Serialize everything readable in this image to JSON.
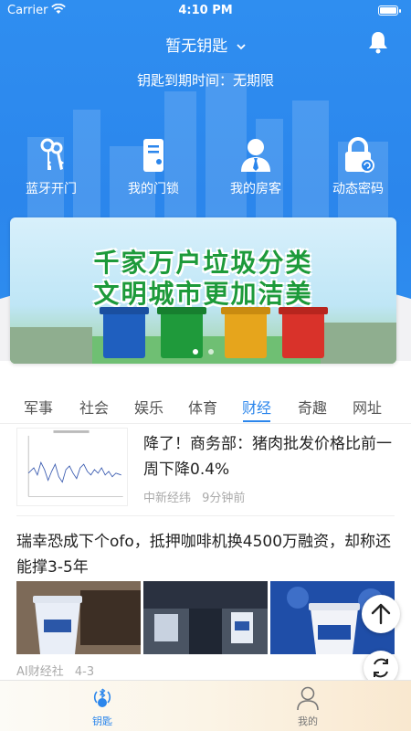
{
  "status_bar": {
    "carrier": "Carrier",
    "time": "4:10 PM"
  },
  "header": {
    "title": "暂无钥匙",
    "expiry": "钥匙到期时间：无期限"
  },
  "actions": [
    {
      "label": "蓝牙开门",
      "icon": "keys-icon"
    },
    {
      "label": "我的门锁",
      "icon": "door-lock-icon"
    },
    {
      "label": "我的房客",
      "icon": "tenant-icon"
    },
    {
      "label": "动态密码",
      "icon": "dynamic-lock-icon"
    }
  ],
  "banner": {
    "line1": "千家万户垃圾分类",
    "line2": "文明城市更加洁美"
  },
  "tabs": [
    "军事",
    "社会",
    "娱乐",
    "体育",
    "财经",
    "奇趣",
    "网址"
  ],
  "active_tab": "财经",
  "news": [
    {
      "title": "降了！商务部：猪肉批发价格比前一周下降0.4%",
      "source": "中新经纬",
      "time": "9分钟前"
    },
    {
      "title": "瑞幸恐成下个ofo，抵押咖啡机换4500万融资，却称还能撑3-5年",
      "source": "AI财经社",
      "time": "4-3"
    }
  ],
  "bottom_nav": [
    {
      "label": "钥匙",
      "active": true
    },
    {
      "label": "我的",
      "active": false
    }
  ],
  "colors": {
    "primary": "#2b86ec",
    "banner_green": "#1d9a3a"
  }
}
